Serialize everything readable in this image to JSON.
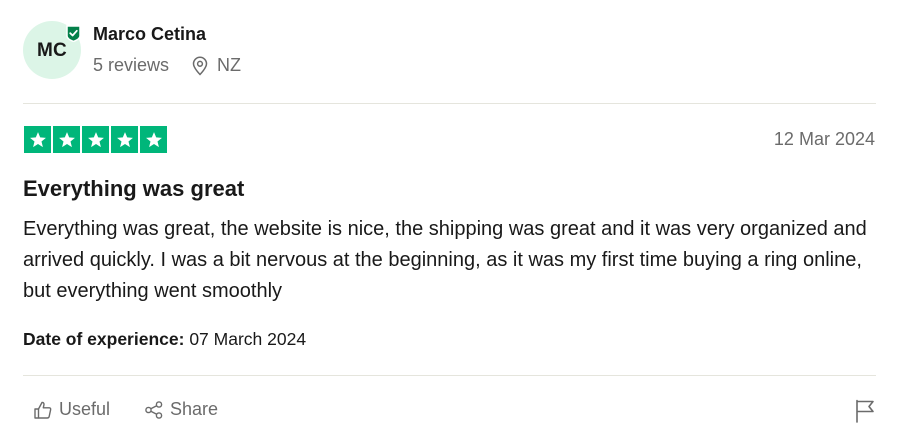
{
  "reviewer": {
    "initials": "MC",
    "name": "Marco Cetina",
    "reviews_count": "5 reviews",
    "location": "NZ"
  },
  "review": {
    "rating": 5,
    "max_rating": 5,
    "date": "12 Mar 2024",
    "title": "Everything was great",
    "body": "Everything was great, the website is nice, the shipping was great and it was very organized and arrived quickly. I was a bit nervous at the beginning, as it was my first time buying a ring online, but everything went smoothly",
    "experience_label": "Date of experience:",
    "experience_date": "07 March 2024"
  },
  "actions": {
    "useful_label": "Useful",
    "share_label": "Share"
  },
  "colors": {
    "star_green": "#00b67a",
    "avatar_bg": "#dcf5e7",
    "verified_green": "#04804a",
    "muted_text": "#6b6b6b",
    "divider": "#e5e5dd"
  },
  "icons": {
    "verified": "verified-badge-icon",
    "location": "location-pin-icon",
    "star": "star-icon",
    "useful": "thumbs-up-icon",
    "share": "share-icon",
    "flag": "flag-icon"
  }
}
